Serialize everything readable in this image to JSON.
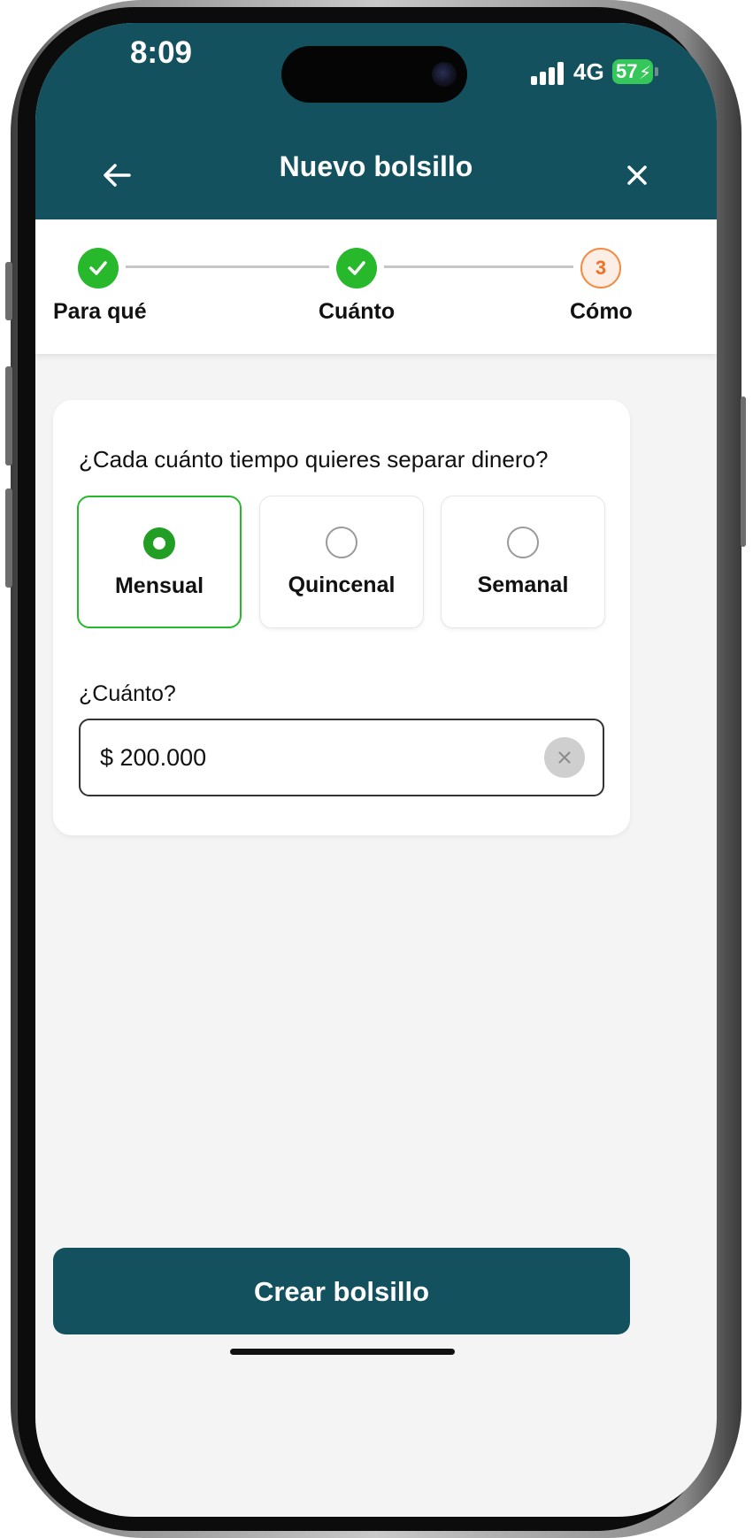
{
  "status_bar": {
    "time": "8:09",
    "network": "4G",
    "battery": "57"
  },
  "header": {
    "title": "Nuevo bolsillo",
    "back_icon": "arrow-left-icon",
    "close_icon": "close-icon"
  },
  "stepper": {
    "steps": [
      {
        "label": "Para qué",
        "state": "done"
      },
      {
        "label": "Cuánto",
        "state": "done"
      },
      {
        "label": "Cómo",
        "state": "current",
        "number": "3"
      }
    ],
    "done_color": "#27b82c",
    "current_color": "#f07125"
  },
  "frequency": {
    "question": "¿Cada cuánto tiempo quieres separar dinero?",
    "options": [
      {
        "label": "Mensual",
        "selected": true
      },
      {
        "label": "Quincenal",
        "selected": false
      },
      {
        "label": "Semanal",
        "selected": false
      }
    ]
  },
  "amount": {
    "label": "¿Cuánto?",
    "value": "$ 200.000"
  },
  "actions": {
    "create_label": "Crear bolsillo"
  },
  "colors": {
    "brand": "#14515f",
    "accent_green": "#27b82c",
    "background": "#f4f4f4"
  }
}
